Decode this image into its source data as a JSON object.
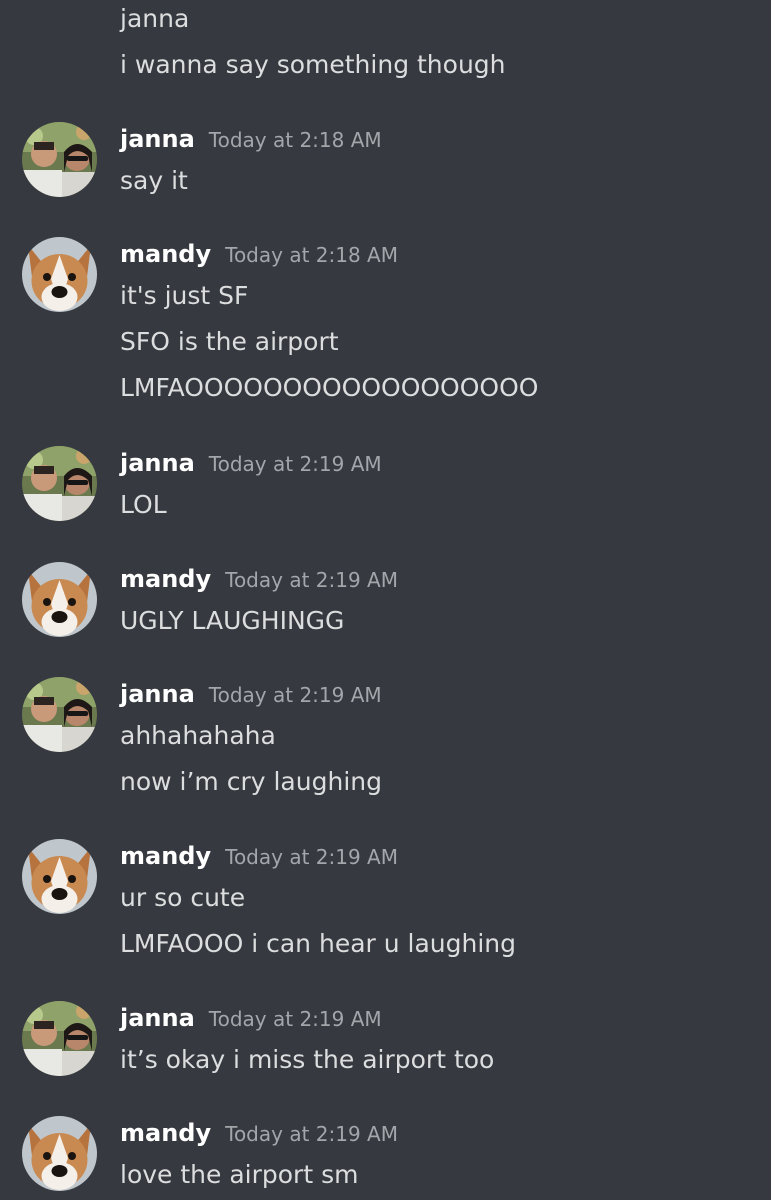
{
  "continuation": {
    "lines": [
      "janna",
      "i wanna say something though"
    ]
  },
  "groups": [
    {
      "author": "janna",
      "avatar": "couple-photo-avatar",
      "timestamp": "Today at 2:18 AM",
      "lines": [
        "say it"
      ]
    },
    {
      "author": "mandy",
      "avatar": "corgi-dog-avatar",
      "timestamp": "Today at 2:18 AM",
      "lines": [
        "it's just SF",
        "SFO is the airport",
        "LMFAOOOOOOOOOOOOOOOOOO"
      ]
    },
    {
      "author": "janna",
      "avatar": "couple-photo-avatar",
      "timestamp": "Today at 2:19 AM",
      "lines": [
        "LOL"
      ]
    },
    {
      "author": "mandy",
      "avatar": "corgi-dog-avatar",
      "timestamp": "Today at 2:19 AM",
      "lines": [
        "UGLY LAUGHINGG"
      ]
    },
    {
      "author": "janna",
      "avatar": "couple-photo-avatar",
      "timestamp": "Today at 2:19 AM",
      "lines": [
        "ahhahahaha",
        "now i’m cry laughing"
      ]
    },
    {
      "author": "mandy",
      "avatar": "corgi-dog-avatar",
      "timestamp": "Today at 2:19 AM",
      "lines": [
        "ur so cute",
        "LMFAOOO i can hear u laughing"
      ]
    },
    {
      "author": "janna",
      "avatar": "couple-photo-avatar",
      "timestamp": "Today at 2:19 AM",
      "lines": [
        "it’s okay i miss the airport too"
      ]
    },
    {
      "author": "mandy",
      "avatar": "corgi-dog-avatar",
      "timestamp": "Today at 2:19 AM",
      "lines": [
        "love the airport sm"
      ]
    }
  ],
  "colors": {
    "background": "#36393f",
    "author": "#ffffff",
    "timestamp": "#a3a6aa",
    "text": "#dcddde"
  }
}
